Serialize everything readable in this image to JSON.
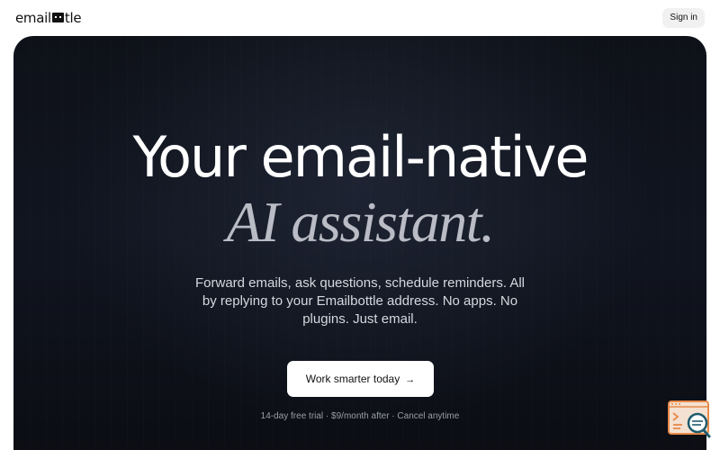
{
  "header": {
    "logo_left": "email",
    "logo_right": "tle",
    "signin_label": "Sign in"
  },
  "hero": {
    "headline_line1": "Your email-native",
    "headline_line2": "AI assistant.",
    "subtitle": "Forward emails, ask questions, schedule reminders. All by replying to your Emailbottle address. No apps. No plugins. Just email.",
    "cta_label": "Work smarter today",
    "cta_arrow": "→",
    "fineprint": "14-day free trial · $9/month after · Cancel anytime"
  },
  "widget": {
    "icon": "code-search-icon"
  },
  "colors": {
    "hero_background": "#0e1118",
    "headline": "#ffffff",
    "headline_italic": "#b9bcc4",
    "cta_background": "#ffffff",
    "widget_accent": "#e88a4a"
  }
}
